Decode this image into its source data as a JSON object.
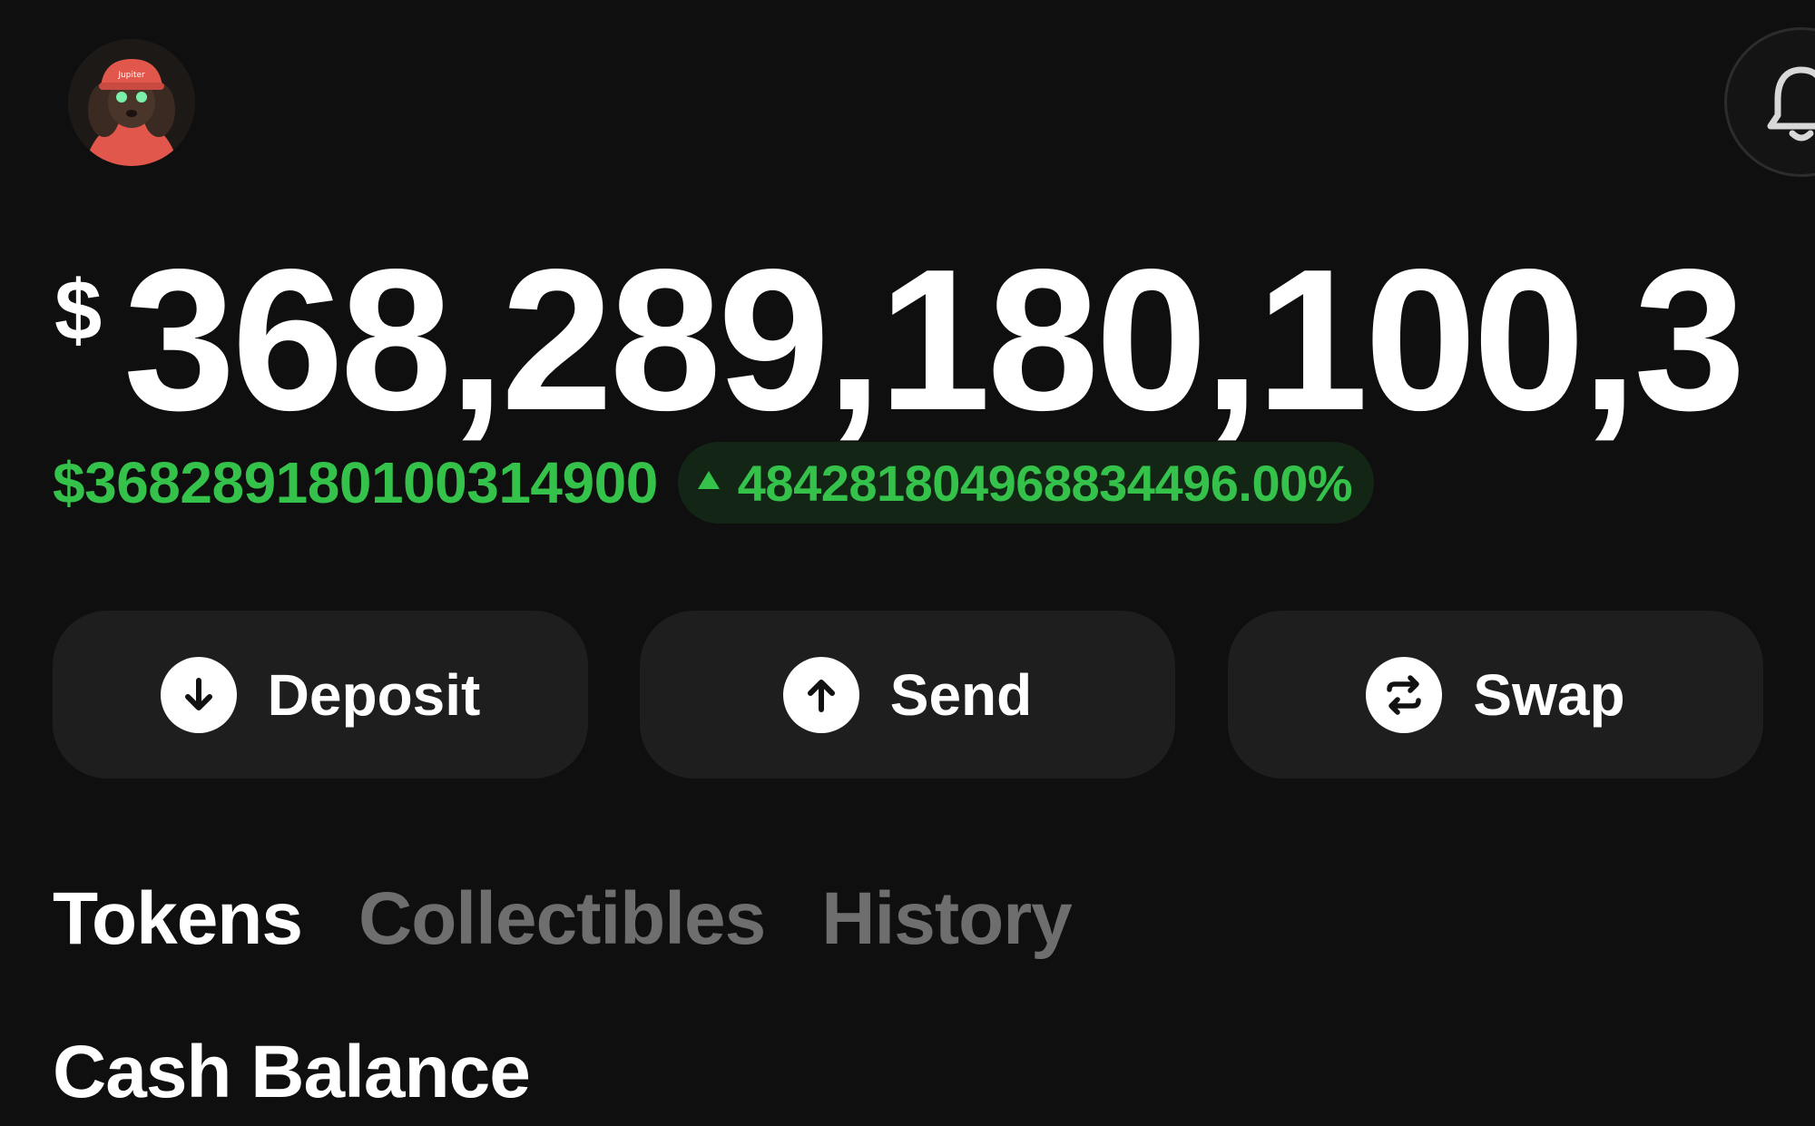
{
  "header": {
    "avatar_icon": "user-avatar-dog-icon",
    "notification_icon": "bell-icon"
  },
  "balance": {
    "currency_symbol": "$",
    "amount": "368,289,180,100,3"
  },
  "change": {
    "value": "$368289180100314900",
    "direction_icon": "triangle-up-icon",
    "percent": "484281804968834496.00%",
    "color": "#35c24a"
  },
  "actions": [
    {
      "label": "Deposit",
      "icon": "arrow-down-circle-icon"
    },
    {
      "label": "Send",
      "icon": "arrow-up-circle-icon"
    },
    {
      "label": "Swap",
      "icon": "swap-arrows-icon"
    }
  ],
  "tabs": [
    {
      "label": "Tokens",
      "active": true
    },
    {
      "label": "Collectibles",
      "active": false
    },
    {
      "label": "History",
      "active": false
    }
  ],
  "section": {
    "title": "Cash Balance"
  }
}
